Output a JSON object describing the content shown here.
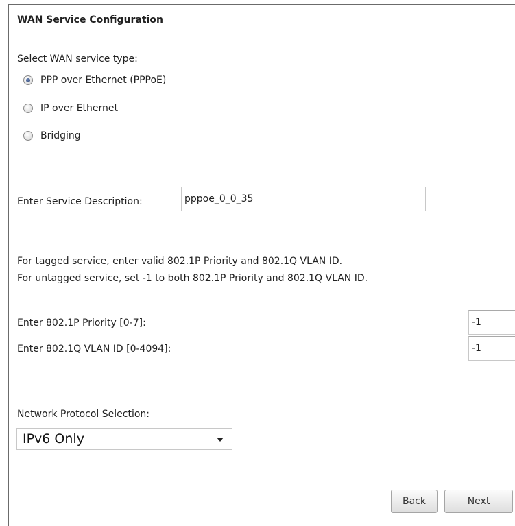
{
  "page": {
    "title": "WAN Service Configuration"
  },
  "service_type": {
    "label": "Select WAN service type:",
    "options": [
      {
        "label": "PPP over Ethernet (PPPoE)",
        "checked": true
      },
      {
        "label": "IP over Ethernet",
        "checked": false
      },
      {
        "label": "Bridging",
        "checked": false
      }
    ]
  },
  "description": {
    "label": "Enter Service Description:",
    "value": "pppoe_0_0_35"
  },
  "vlan_info": {
    "line1": "For tagged service, enter valid 802.1P Priority and 802.1Q VLAN ID.",
    "line2": "For untagged service, set -1 to both 802.1P Priority and 802.1Q VLAN ID."
  },
  "priority": {
    "label": "Enter 802.1P Priority [0-7]:",
    "value": "-1"
  },
  "vlan_id": {
    "label": "Enter 802.1Q VLAN ID [0-4094]:",
    "value": "-1"
  },
  "protocol": {
    "label": "Network Protocol Selection:",
    "selected": "IPv6 Only"
  },
  "buttons": {
    "back": "Back",
    "next": "Next"
  }
}
